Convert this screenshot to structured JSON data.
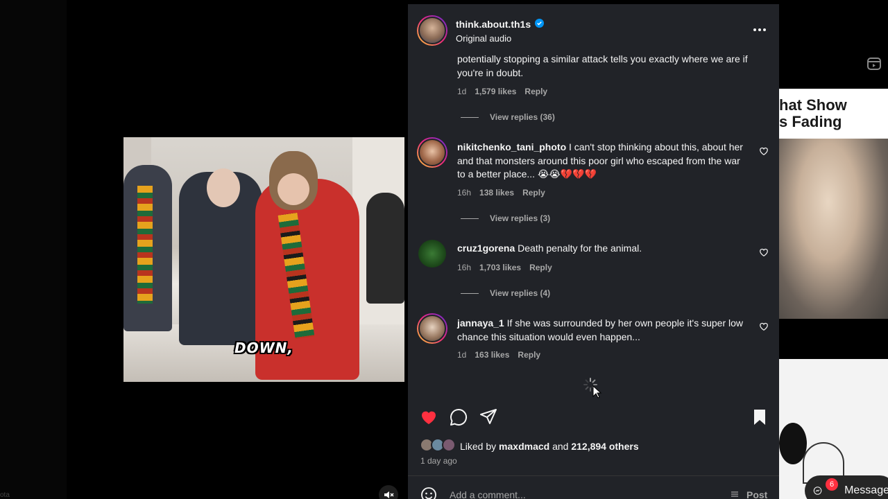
{
  "background": {
    "corner_label": "ota"
  },
  "video": {
    "caption": "DOWN,"
  },
  "post": {
    "username": "think.about.th1s",
    "subtitle": "Original audio"
  },
  "comments": [
    {
      "username": "",
      "text": "potentially stopping a similar attack tells you exactly where we are if you're in doubt.",
      "age": "1d",
      "likes": "1,579 likes",
      "reply_label": "Reply",
      "view_replies": "View replies (36)"
    },
    {
      "username": "nikitchenko_tani_photo",
      "text": "I can't stop thinking about this, about her and that monsters around this poor girl who escaped from the war to a better place... 😭😭💔💔💔",
      "age": "16h",
      "likes": "138 likes",
      "reply_label": "Reply",
      "view_replies": "View replies (3)"
    },
    {
      "username": "cruz1gorena",
      "text": "Death penalty for the animal.",
      "age": "16h",
      "likes": "1,703 likes",
      "reply_label": "Reply",
      "view_replies": "View replies (4)"
    },
    {
      "username": "jannaya_1",
      "text": "If she was surrounded by her own people it's super low chance this situation would even happen...",
      "age": "1d",
      "likes": "163 likes",
      "reply_label": "Reply",
      "view_replies": ""
    }
  ],
  "likes": {
    "prefix": "Liked by",
    "user": "maxdmacd",
    "joiner": "and",
    "others": "212,894 others",
    "time_ago": "1 day ago"
  },
  "add_comment": {
    "placeholder": "Add a comment...",
    "post_label": "Post"
  },
  "side": {
    "thumb_title_line1": "hat Show",
    "thumb_title_line2": "s Fading",
    "messages_label": "Messages",
    "messages_badge": "6"
  },
  "colors": {
    "like_red": "#ff3040",
    "panel_bg": "#212328",
    "verified_blue": "#0095f6"
  }
}
